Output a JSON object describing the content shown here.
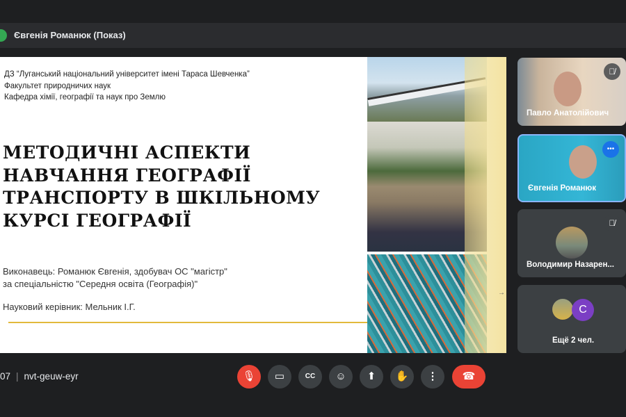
{
  "top_bar": {
    "presenter_label": "Євгенія Романюк (Показ)"
  },
  "slide": {
    "institution_lines": [
      "ДЗ “Луганський національний університет імені Тараса Шевченка”",
      "Факультет природничих наук",
      "Кафедра хімії, географії та наук про Землю"
    ],
    "title_lines": [
      "МЕТОДИЧНІ АСПЕКТИ",
      "НАВЧАННЯ ГЕОГРАФІЇ",
      "ТРАНСПОРТУ В ШКІЛЬНОМУ",
      "КУРСІ ГЕОГРАФІЇ"
    ],
    "author_lines": [
      "Виконавець: Романюк Євгенія, здобувач ОС \"магістр\"",
      "за спеціальністю \"Середня освіта (Географія)\""
    ],
    "supervisor": "Науковий керівник: Мельник І.Г.",
    "next_arrow": "→",
    "accent_color": "#e2b93b"
  },
  "participants": [
    {
      "name": "Павло Анатолійович",
      "status": "muted"
    },
    {
      "name": "Євгенія Романюк",
      "status": "speaking"
    },
    {
      "name": "Володимир Назарен...",
      "status": "muted"
    },
    {
      "name": "Ещё 2 чел.",
      "avatar_letter": "C"
    }
  ],
  "bottom_bar": {
    "time_fragment": "07",
    "meeting_code": "nvt-geuw-eyr"
  },
  "controls": {
    "mic": "mic-off",
    "camera": "camera",
    "captions": "CC",
    "emoji": "emoji",
    "present": "present",
    "hand": "raise-hand",
    "more": "more",
    "end": "end-call"
  }
}
